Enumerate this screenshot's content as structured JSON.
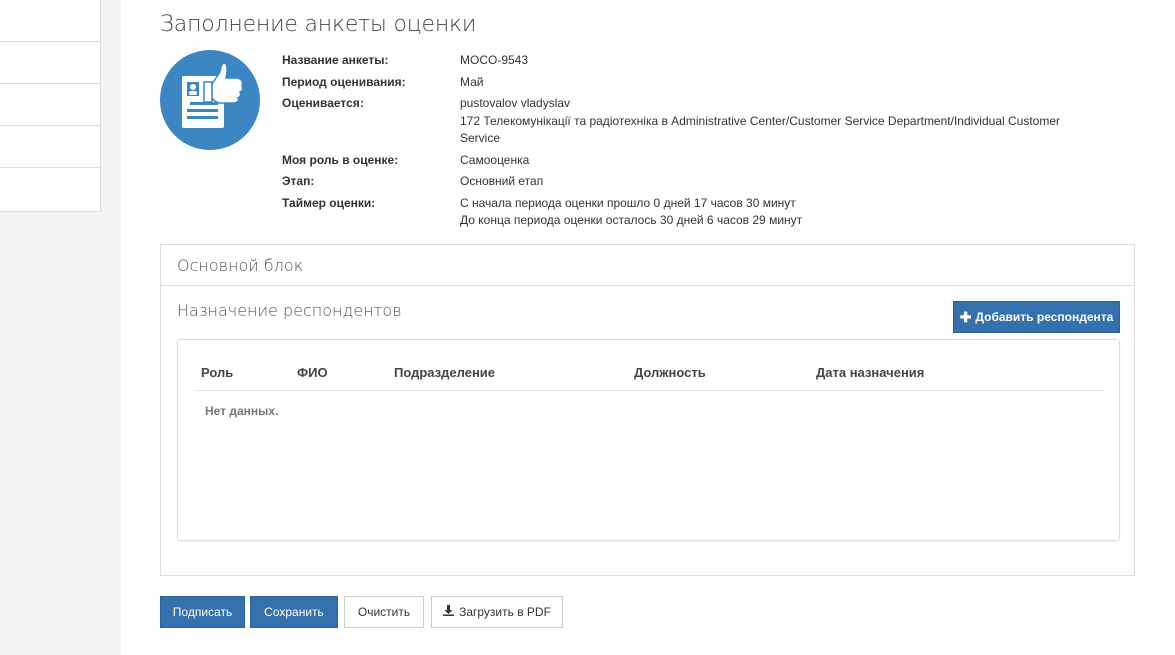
{
  "page": {
    "title": "Заполнение анкеты оценки"
  },
  "info": {
    "rows": [
      {
        "label": "Название анкеты:",
        "lines": [
          "MOCO-9543"
        ]
      },
      {
        "label": "Период оценивания:",
        "lines": [
          "Май"
        ]
      },
      {
        "label": "Оценивается:",
        "lines": [
          "pustovalov vladyslav",
          "172 Телекомунікації та радіотехніка в Administrative Center/Customer Service Department/Individual Customer Service"
        ]
      },
      {
        "label": "Моя роль в оценке:",
        "lines": [
          "Самооценка"
        ]
      },
      {
        "label": "Этап:",
        "lines": [
          "Основний етап"
        ]
      },
      {
        "label": "Таймер оценки:",
        "lines": [
          "С начала периода оценки прошло 0 дней 17 часов 30 минут",
          "До конца периода оценки осталось 30 дней 6 часов 29 минут"
        ]
      }
    ]
  },
  "block": {
    "title": "Основной блок",
    "section_title": "Назначение респондентов",
    "add_button": "Добавить респондента",
    "columns": [
      "Роль",
      "ФИО",
      "Подразделение",
      "Должность",
      "Дата назначения"
    ],
    "empty_text": "Нет данных."
  },
  "actions": {
    "sign": "Подписать",
    "save": "Сохранить",
    "clear": "Очистить",
    "pdf": "Загрузить в PDF"
  },
  "colors": {
    "primary": "#3471ac",
    "avatar": "#3c86c4"
  },
  "icons": {
    "avatar": "profile-card-thumbs-up-icon",
    "add": "plus-icon",
    "download": "download-icon"
  }
}
